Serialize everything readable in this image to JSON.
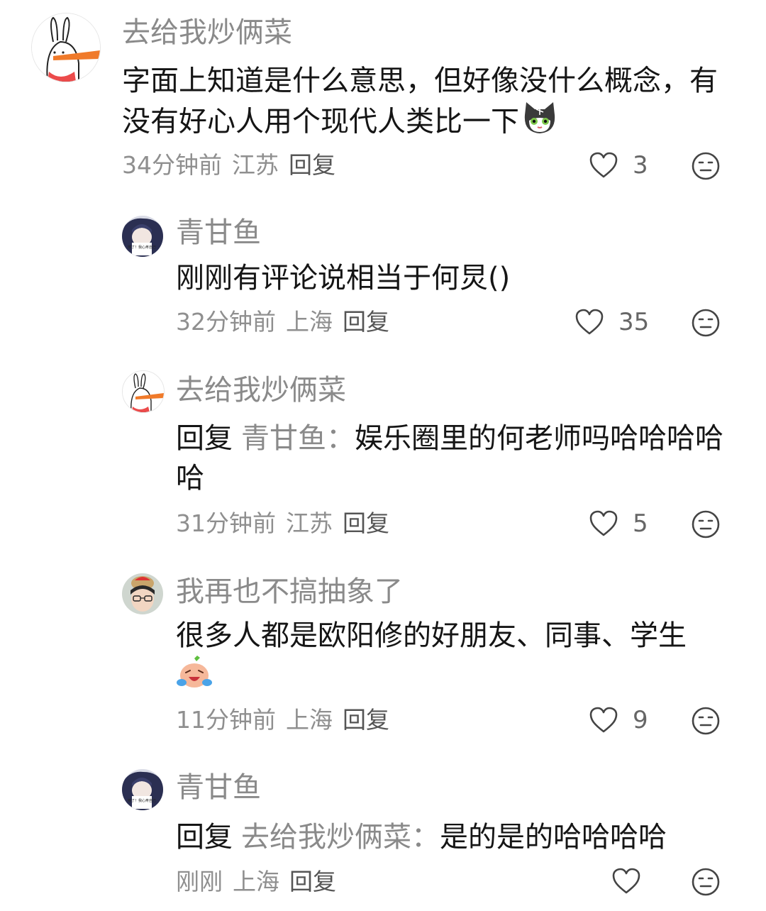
{
  "comments": [
    {
      "name": "去给我炒俩菜",
      "text": "字面上知道是什么意思，但好像没什么概念，有没有好心人用个现代人类比一下",
      "emoji": "cat-face-emoji",
      "time": "34分钟前",
      "location": "江苏",
      "reply_label": "回复",
      "likes": "3"
    },
    {
      "name": "青甘鱼",
      "text": "刚刚有评论说相当于何炅()",
      "time": "32分钟前",
      "location": "上海",
      "reply_label": "回复",
      "likes": "35"
    },
    {
      "name": "去给我炒俩菜",
      "reply_prefix": "回复",
      "reply_to": "青甘鱼：",
      "text": "娱乐圈里的何老师吗哈哈哈哈哈",
      "time": "31分钟前",
      "location": "江苏",
      "reply_label": "回复",
      "likes": "5"
    },
    {
      "name": "我再也不搞抽象了",
      "text": "很多人都是欧阳修的好朋友、同事、学生",
      "emoji": "crying-laughing-emoji",
      "time": "11分钟前",
      "location": "上海",
      "reply_label": "回复",
      "likes": "9"
    },
    {
      "name": "青甘鱼",
      "reply_prefix": "回复",
      "reply_to": "去给我炒俩菜：",
      "text": "是的是的哈哈哈哈",
      "time": "刚刚",
      "location": "上海",
      "reply_label": "回复",
      "likes": ""
    }
  ],
  "avatar_badge_text": "够了！我心疼自己",
  "colors": {
    "name_gray": "#8a8a8a",
    "icon_gray": "#444444",
    "carrot": "#f07a2a"
  }
}
